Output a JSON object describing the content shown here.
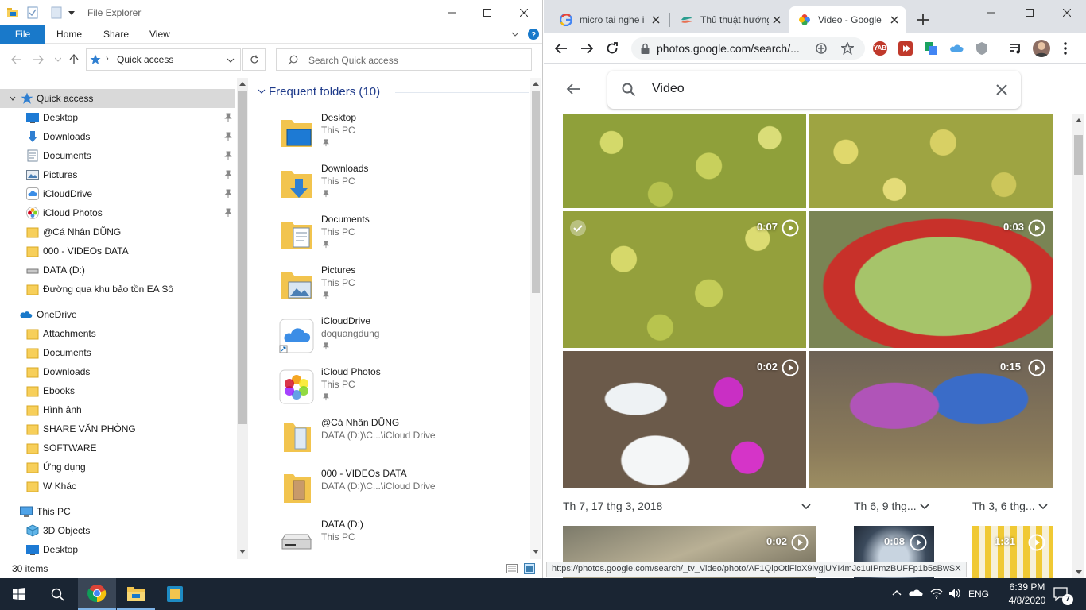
{
  "explorer": {
    "title": "File Explorer",
    "ribbon": {
      "file": "File",
      "home": "Home",
      "share": "Share",
      "view": "View"
    },
    "address": {
      "location": "Quick access"
    },
    "search": {
      "placeholder": "Search Quick access"
    },
    "nav": {
      "quick_access": "Quick access",
      "pinned": [
        "Desktop",
        "Downloads",
        "Documents",
        "Pictures",
        "iCloudDrive",
        "iCloud Photos"
      ],
      "recent_folders": [
        "@Cá Nhân DŨNG",
        "000 - VIDEOs DATA",
        "DATA (D:)",
        "Đường qua khu bảo tồn EA Sô"
      ],
      "onedrive": "OneDrive",
      "onedrive_items": [
        "Attachments",
        "Documents",
        "Downloads",
        "Ebooks",
        "Hình ảnh",
        "SHARE VĂN PHÒNG",
        "SOFTWARE",
        "Ứng dụng",
        "W Khác"
      ],
      "this_pc": "This PC",
      "this_pc_items": [
        "3D Objects",
        "Desktop"
      ]
    },
    "content": {
      "group_header": "Frequent folders (10)",
      "tiles": [
        {
          "name": "Desktop",
          "sub": "This PC"
        },
        {
          "name": "Downloads",
          "sub": "This PC"
        },
        {
          "name": "Documents",
          "sub": "This PC"
        },
        {
          "name": "Pictures",
          "sub": "This PC"
        },
        {
          "name": "iCloudDrive",
          "sub": "doquangdung"
        },
        {
          "name": "iCloud Photos",
          "sub": "This PC"
        },
        {
          "name": "@Cá Nhân DŨNG",
          "sub": "DATA (D:)\\C...\\iCloud Drive"
        },
        {
          "name": "000 - VIDEOs DATA",
          "sub": "DATA (D:)\\C...\\iCloud Drive"
        },
        {
          "name": "DATA (D:)",
          "sub": "This PC"
        }
      ]
    },
    "status": "30 items"
  },
  "chrome": {
    "tabs": [
      {
        "title": "micro tai nghe i"
      },
      {
        "title": "Thủ thuật hướng"
      },
      {
        "title": "Video - Google"
      }
    ],
    "omnibox_url": "photos.google.com/search/...",
    "ext_yab_label": "YAB",
    "page": {
      "search_text": "Video",
      "videos": [
        {
          "duration": "0:07"
        },
        {
          "duration": "0:03"
        },
        {
          "duration": "0:02"
        },
        {
          "duration": "0:15"
        }
      ],
      "date_headers": [
        "Th 7, 17 thg 3, 2018",
        "Th 6, 9 thg...",
        "Th 3, 6 thg..."
      ],
      "bottom_videos": [
        {
          "duration": "0:02"
        },
        {
          "duration": "0:08"
        },
        {
          "duration": "1:31"
        }
      ],
      "status_url": "https://photos.google.com/search/_tv_Video/photo/AF1QipOtlFloX9ivgjUYI4mJc1uIPmzBUFFp1b5sBwSX"
    }
  },
  "taskbar": {
    "lang": "ENG",
    "time": "6:39 PM",
    "date": "4/8/2020",
    "notifications": "7"
  },
  "colors": {
    "accent": "#1979ca",
    "taskbar": "#1a2533",
    "chrome_tabbar": "#dee1e6",
    "folder_yellow": "#f7cf5a"
  }
}
